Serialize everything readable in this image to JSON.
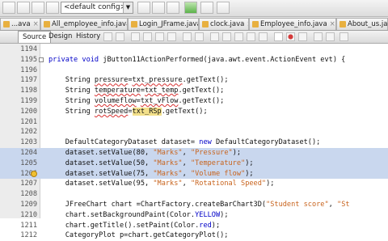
{
  "toolbar": {
    "config_value": "<default config>"
  },
  "file_tabs": [
    {
      "label": "...ava",
      "close": "×"
    },
    {
      "label": "All_employee_info.java",
      "close": "×"
    },
    {
      "label": "Login_JFrame.java",
      "close": "×"
    },
    {
      "label": "clock.java",
      "close": "×"
    },
    {
      "label": "Employee_info.java",
      "close": "×"
    },
    {
      "label": "About_us.java",
      "close": ""
    }
  ],
  "modes": [
    "Source",
    "Design",
    "History"
  ],
  "editor": {
    "lines": [
      {
        "num": "1194",
        "segs": []
      },
      {
        "num": "1195",
        "segs": [
          [
            "kw",
            "private void "
          ],
          [
            "plain",
            "jButton11ActionPerformed(java.awt.event.ActionEvent evt) {"
          ]
        ]
      },
      {
        "num": "1196",
        "segs": []
      },
      {
        "num": "1197",
        "segs": [
          [
            "plain",
            "    String "
          ],
          [
            "sq",
            "pressure"
          ],
          [
            "plain",
            "="
          ],
          [
            "sq",
            "txt_pressure"
          ],
          [
            "plain",
            ".getText();"
          ]
        ]
      },
      {
        "num": "1198",
        "segs": [
          [
            "plain",
            "    String "
          ],
          [
            "sq",
            "temperature"
          ],
          [
            "plain",
            "="
          ],
          [
            "sq",
            "txt_temp"
          ],
          [
            "plain",
            ".getText();"
          ]
        ]
      },
      {
        "num": "1199",
        "segs": [
          [
            "plain",
            "    String "
          ],
          [
            "sq",
            "volumeflow"
          ],
          [
            "plain",
            "="
          ],
          [
            "sq",
            "txt_vFlow"
          ],
          [
            "plain",
            ".getText();"
          ]
        ]
      },
      {
        "num": "1200",
        "segs": [
          [
            "plain",
            "    String "
          ],
          [
            "sq",
            "rotSpeed"
          ],
          [
            "plain",
            "="
          ],
          [
            "hlw",
            "txt_RSp"
          ],
          [
            "plain",
            ".getText();"
          ]
        ]
      },
      {
        "num": "1201",
        "segs": []
      },
      {
        "num": "1202",
        "segs": []
      },
      {
        "num": "1203",
        "segs": [
          [
            "plain",
            "    DefaultCategoryDataset dataset= "
          ],
          [
            "kw",
            "new "
          ],
          [
            "plain",
            "DefaultCategoryDataset();"
          ]
        ]
      },
      {
        "num": "1204",
        "segs": [
          [
            "plain",
            "    dataset.setValue(80, "
          ],
          [
            "str",
            "\"Marks\""
          ],
          [
            "plain",
            ", "
          ],
          [
            "str",
            "\"Pressure\""
          ],
          [
            "plain",
            ");"
          ]
        ]
      },
      {
        "num": "1205",
        "segs": [
          [
            "plain",
            "    dataset.setValue(50, "
          ],
          [
            "str",
            "\"Marks\""
          ],
          [
            "plain",
            ", "
          ],
          [
            "str",
            "\"Temperature\""
          ],
          [
            "plain",
            ");"
          ]
        ]
      },
      {
        "num": "1206",
        "segs": [
          [
            "plain",
            "    dataset.setValue(75, "
          ],
          [
            "str",
            "\"Marks\""
          ],
          [
            "plain",
            ", "
          ],
          [
            "str",
            "\"Volume flow\""
          ],
          [
            "plain",
            ");"
          ]
        ]
      },
      {
        "num": "1207",
        "segs": [
          [
            "plain",
            "    dataset.setValue(95, "
          ],
          [
            "str",
            "\"Marks\""
          ],
          [
            "plain",
            ", "
          ],
          [
            "str",
            "\"Rotational Speed\""
          ],
          [
            "plain",
            ");"
          ]
        ]
      },
      {
        "num": "1208",
        "segs": []
      },
      {
        "num": "1209",
        "segs": [
          [
            "plain",
            "    JFreeChart chart =ChartFactory.createBarChart3D("
          ],
          [
            "str",
            "\"Student score\""
          ],
          [
            "plain",
            ", "
          ],
          [
            "str",
            "\"St"
          ]
        ]
      },
      {
        "num": "1210",
        "segs": [
          [
            "plain",
            "    chart.setBackgroundPaint(Color."
          ],
          [
            "kw",
            "YELLOW"
          ],
          [
            "plain",
            ");"
          ]
        ]
      },
      {
        "num": "1211",
        "segs": [
          [
            "plain",
            "    chart.getTitle().setPaint(Color."
          ],
          [
            "kw",
            "red"
          ],
          [
            "plain",
            ");"
          ]
        ]
      },
      {
        "num": "1212",
        "segs": [
          [
            "plain",
            "    CategoryPlot p=chart.getCategoryPlot();"
          ]
        ]
      }
    ]
  }
}
